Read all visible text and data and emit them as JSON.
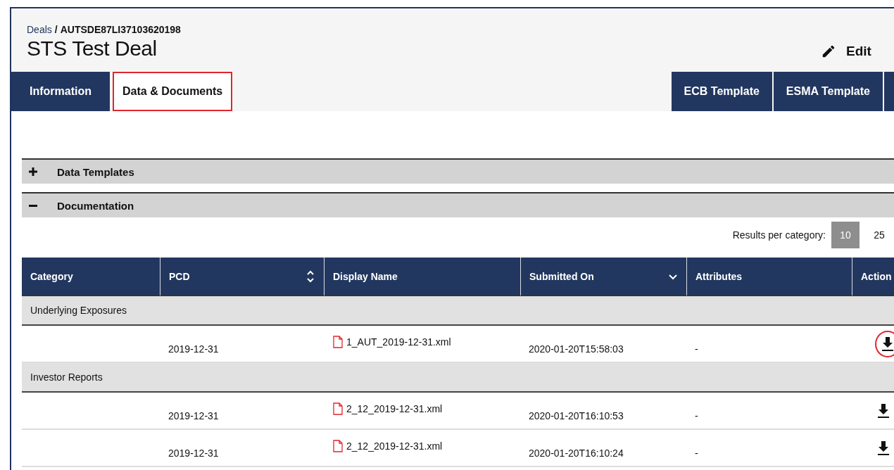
{
  "breadcrumb": {
    "link": "Deals",
    "separator": "/",
    "current": "AUTSDE87LI37103620198"
  },
  "title": "STS Test Deal",
  "edit_button": {
    "label": "Edit"
  },
  "tabs": [
    {
      "label": "Information",
      "selected": false
    },
    {
      "label": "Data & Documents",
      "selected": true
    }
  ],
  "right_tabs": [
    {
      "label": "ECB Template",
      "selected": false
    },
    {
      "label": "ESMA Template",
      "selected": false
    }
  ],
  "sections": [
    {
      "label": "Data Templates",
      "expanded": false
    },
    {
      "label": "Documentation",
      "expanded": true
    }
  ],
  "results_per_category": {
    "label": "Results per category:",
    "options": [
      {
        "label": "10",
        "selected": true
      },
      {
        "label": "25",
        "selected": false
      }
    ]
  },
  "table": {
    "columns": [
      {
        "label": "Category"
      },
      {
        "label": "PCD",
        "sortable": true,
        "sorted": false
      },
      {
        "label": "Display Name"
      },
      {
        "label": "Submitted On",
        "sortable": true,
        "sorted": true
      },
      {
        "label": "Attributes"
      },
      {
        "label": "Action"
      }
    ],
    "groups": [
      {
        "category": "Underlying Exposures",
        "rows": [
          {
            "pcd": "2019-12-31",
            "display_name": "1_AUT_2019-12-31.xml",
            "submitted_on": "2020-01-20T15:58:03",
            "attributes": "-",
            "highlighted": true
          }
        ]
      },
      {
        "category": "Investor Reports",
        "rows": [
          {
            "pcd": "2019-12-31",
            "display_name": "2_12_2019-12-31.xml",
            "submitted_on": "2020-01-20T16:10:53",
            "attributes": "-",
            "highlighted": false
          },
          {
            "pcd": "2019-12-31",
            "display_name": "2_12_2019-12-31.xml",
            "submitted_on": "2020-01-20T16:10:24",
            "attributes": "-",
            "highlighted": false
          }
        ]
      }
    ]
  }
}
